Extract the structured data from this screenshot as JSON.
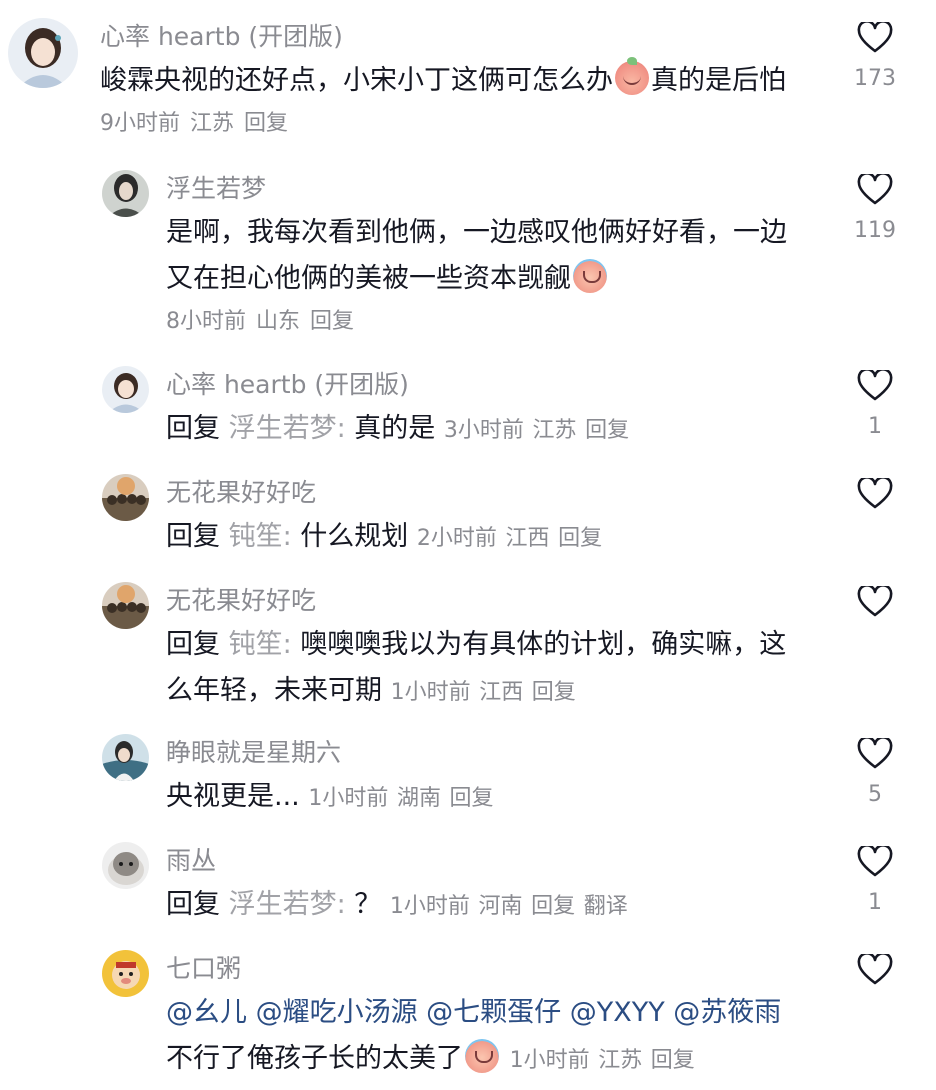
{
  "comments": [
    {
      "username": "心率 heartb (开团版)",
      "text_before": "峻霖央视的还好点，小宋小丁这俩可怎么办",
      "emoji": "peach-emoji",
      "text_after": "真的是后怕",
      "time": "9小时前",
      "location": "江苏",
      "reply_label": "回复",
      "likes": "173"
    },
    {
      "username": "浮生若梦",
      "text_before": "是啊，我每次看到他俩，一边感叹他俩好好看，一边又在担心他俩的美被一些资本觊觎",
      "emoji": "crying-emoji",
      "time": "8小时前",
      "location": "山东",
      "reply_label": "回复",
      "likes": "119"
    },
    {
      "username": "心率 heartb (开团版)",
      "reply_prefix": "回复",
      "reply_target": "浮生若梦:",
      "text": "真的是",
      "time": "3小时前",
      "location": "江苏",
      "reply_label": "回复",
      "likes": "1"
    },
    {
      "username": "无花果好好吃",
      "reply_prefix": "回复",
      "reply_target": "钝笙:",
      "text": "什么规划",
      "time": "2小时前",
      "location": "江西",
      "reply_label": "回复",
      "likes": ""
    },
    {
      "username": "无花果好好吃",
      "reply_prefix": "回复",
      "reply_target": "钝笙:",
      "text": "噢噢噢我以为有具体的计划，确实嘛，这么年轻，未来可期",
      "time": "1小时前",
      "location": "江西",
      "reply_label": "回复",
      "likes": ""
    },
    {
      "username": "睁眼就是星期六",
      "text": "央视更是...",
      "time": "1小时前",
      "location": "湖南",
      "reply_label": "回复",
      "likes": "5"
    },
    {
      "username": "雨丛",
      "reply_prefix": "回复",
      "reply_target": "浮生若梦:",
      "text": "？",
      "time": "1小时前",
      "location": "河南",
      "reply_label": "回复",
      "translate_label": "翻译",
      "likes": "1"
    },
    {
      "username": "七口粥",
      "mentions": "@幺儿 @耀吃小汤源 @七颗蛋仔 @YXYY @苏筱雨",
      "text": "不行了俺孩子长的太美了",
      "emoji": "crying-emoji",
      "time": "1小时前",
      "location": "江苏",
      "reply_label": "回复",
      "likes": ""
    }
  ],
  "colors": {
    "username": "#8a8b91",
    "text": "#161823",
    "mention": "#2b4d83",
    "heart_stroke": "#161823"
  }
}
